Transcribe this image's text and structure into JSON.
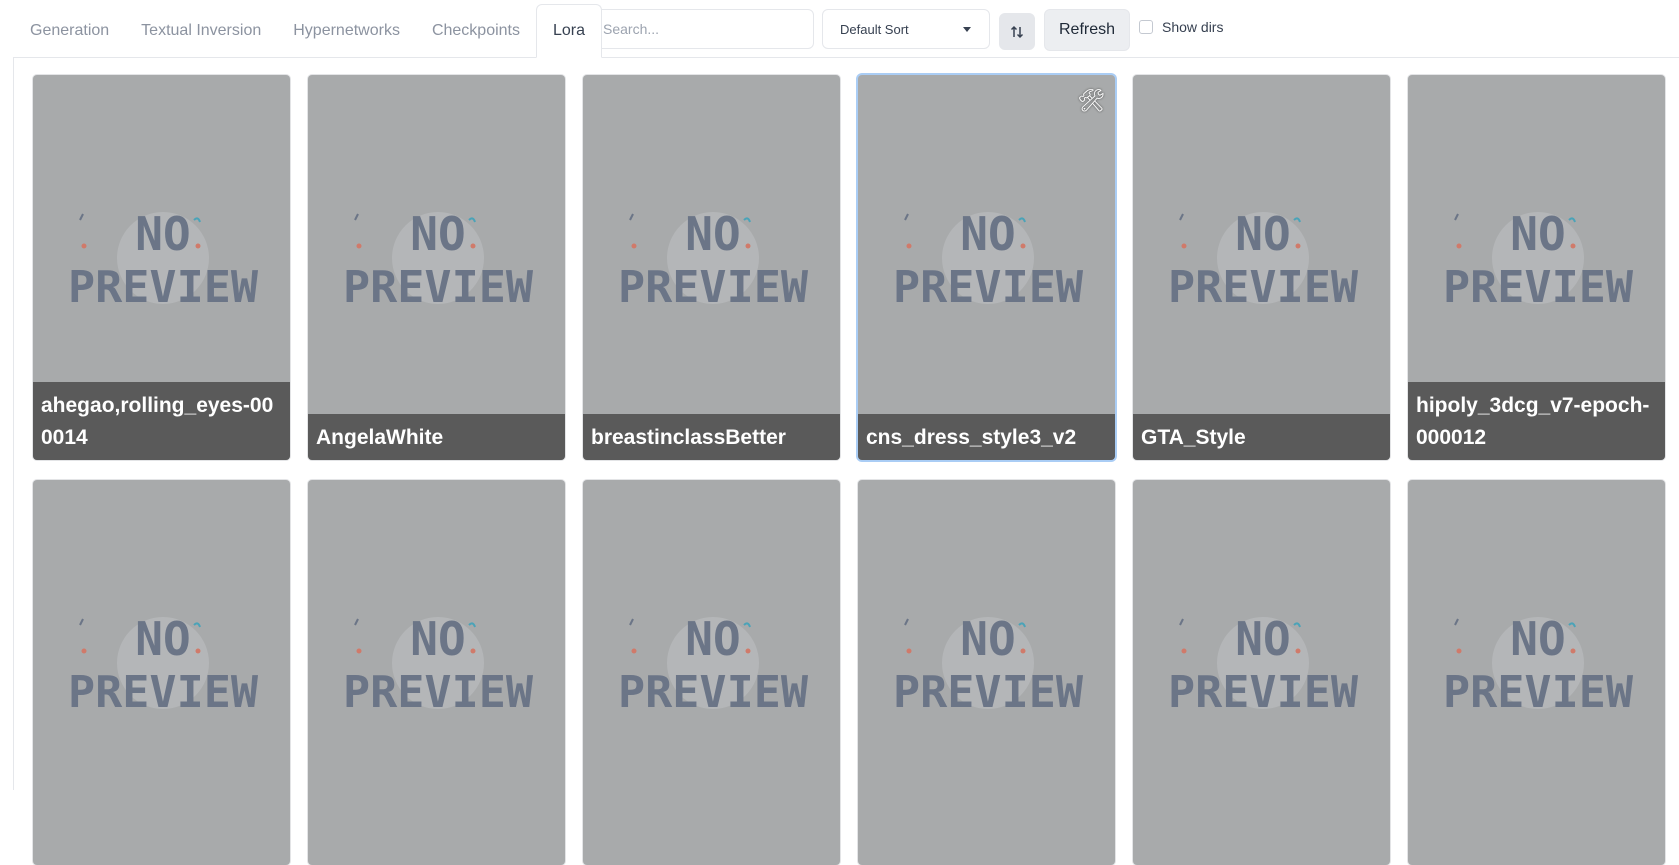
{
  "tabs": [
    {
      "label": "Generation",
      "active": false
    },
    {
      "label": "Textual Inversion",
      "active": false
    },
    {
      "label": "Hypernetworks",
      "active": false
    },
    {
      "label": "Checkpoints",
      "active": false
    },
    {
      "label": "Lora",
      "active": true
    }
  ],
  "search": {
    "placeholder": "Search...",
    "value": ""
  },
  "sort": {
    "selected": "Default Sort"
  },
  "sort_direction_icon": "sort-direction-icon",
  "refresh_label": "Refresh",
  "show_dirs": {
    "label": "Show dirs",
    "checked": false
  },
  "preview_placeholder": {
    "line1": "NO",
    "line2": "PREVIEW"
  },
  "cards": [
    {
      "name": "ahegao,rolling_eyes-000014"
    },
    {
      "name": "AngelaWhite"
    },
    {
      "name": "breastinclassBetter"
    },
    {
      "name": "cns_dress_style3_v2",
      "selected": true,
      "icon": "tools-icon"
    },
    {
      "name": "GTA_Style"
    },
    {
      "name": "hipoly_3dcg_v7-epoch-000012"
    },
    {
      "name": ""
    },
    {
      "name": ""
    },
    {
      "name": ""
    },
    {
      "name": ""
    },
    {
      "name": ""
    },
    {
      "name": ""
    }
  ],
  "colors": {
    "card_bg": "#a8aaab",
    "label_bg": "#5a5a5a",
    "placeholder_text": "#6b7587",
    "selected_border": "#aacdf5"
  }
}
